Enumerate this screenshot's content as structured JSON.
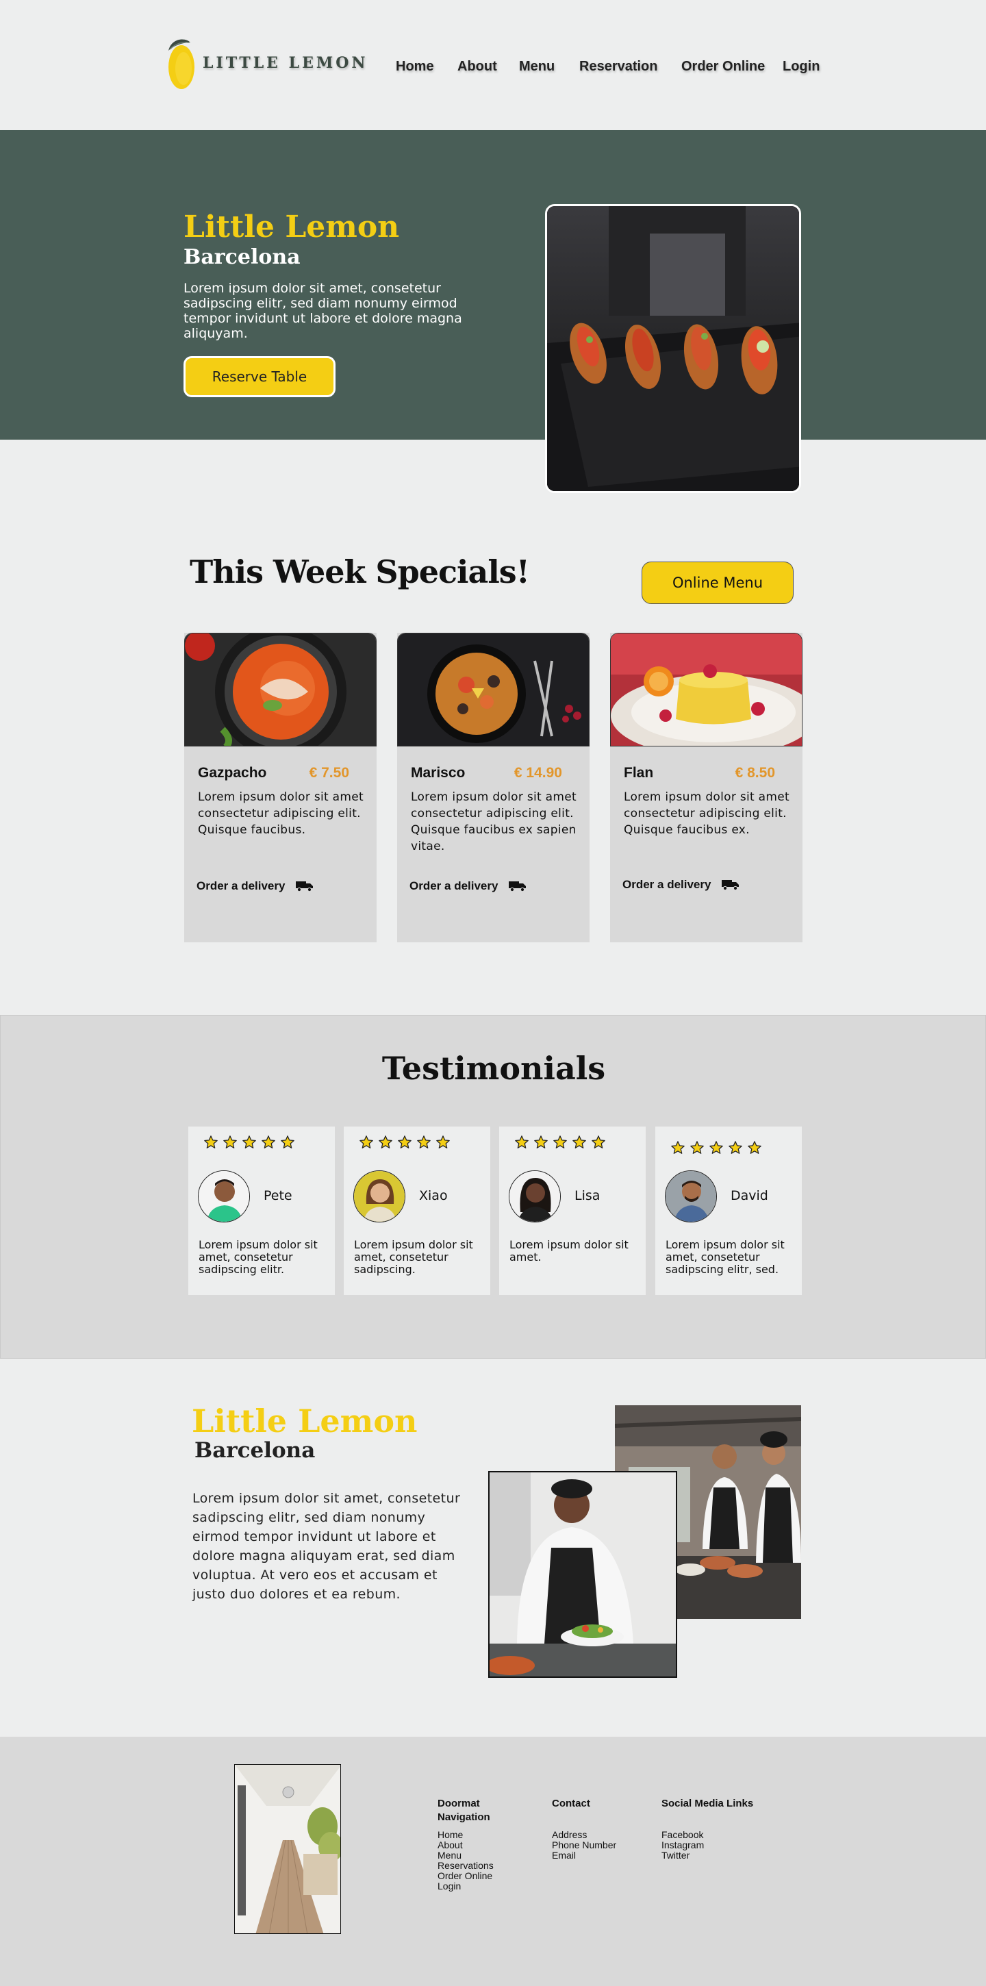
{
  "brand": {
    "logo_text": "LITTLE LEMON",
    "primary_color": "#f4ce14",
    "dark_green": "#495e57",
    "price_color": "#e2962b"
  },
  "nav": {
    "items": [
      {
        "label": "Home"
      },
      {
        "label": "About"
      },
      {
        "label": "Menu"
      },
      {
        "label": "Reservation"
      },
      {
        "label": "Order Online"
      },
      {
        "label": "Login"
      }
    ]
  },
  "hero": {
    "title": "Little Lemon",
    "subtitle": "Barcelona",
    "description": "Lorem ipsum dolor sit amet, consetetur sadipscing elitr, sed diam nonumy eirmod tempor invidunt ut labore et dolore magna aliquyam.",
    "cta_label": "Reserve Table"
  },
  "specials": {
    "title": "This Week Specials!",
    "menu_button_label": "Online Menu",
    "items": [
      {
        "name": "Gazpacho",
        "price": "€ 7.50",
        "description": "Lorem ipsum dolor sit amet consectetur adipiscing elit. Quisque faucibus.",
        "order_label": "Order a delivery",
        "icon": "truck-icon"
      },
      {
        "name": "Marisco",
        "price": "€ 14.90",
        "description": "Lorem ipsum dolor sit amet consectetur adipiscing elit. Quisque faucibus ex sapien vitae.",
        "order_label": "Order a delivery",
        "icon": "truck-icon"
      },
      {
        "name": "Flan",
        "price": "€ 8.50",
        "description": "Lorem ipsum dolor sit amet consectetur adipiscing elit. Quisque faucibus ex.",
        "order_label": "Order a delivery",
        "icon": "truck-icon"
      }
    ]
  },
  "testimonials": {
    "title": "Testimonials",
    "items": [
      {
        "name": "Pete",
        "rating": 5,
        "text": "Lorem ipsum dolor sit amet, consetetur sadipscing elitr."
      },
      {
        "name": "Xiao",
        "rating": 5,
        "text": "Lorem ipsum dolor sit amet, consetetur sadipscing."
      },
      {
        "name": "Lisa",
        "rating": 5,
        "text": "Lorem ipsum dolor sit amet."
      },
      {
        "name": "David",
        "rating": 5,
        "text": "Lorem ipsum dolor sit amet, consetetur sadipscing elitr, sed."
      }
    ]
  },
  "about": {
    "title": "Little Lemon",
    "subtitle": "Barcelona",
    "description": "Lorem ipsum dolor sit amet, consetetur sadipscing elitr, sed diam nonumy eirmod tempor invidunt ut labore et dolore magna aliquyam erat, sed diam voluptua. At vero eos et accusam et justo duo dolores et ea rebum."
  },
  "footer": {
    "columns": [
      {
        "heading": "Doormat Navigation",
        "links": [
          "Home",
          "About",
          "Menu",
          "Reservations",
          "Order Online",
          "Login"
        ]
      },
      {
        "heading": "Contact",
        "links": [
          "Address",
          "Phone Number",
          "Email"
        ]
      },
      {
        "heading": "Social Media Links",
        "links": [
          "Facebook",
          "Instagram",
          "Twitter"
        ]
      }
    ]
  }
}
